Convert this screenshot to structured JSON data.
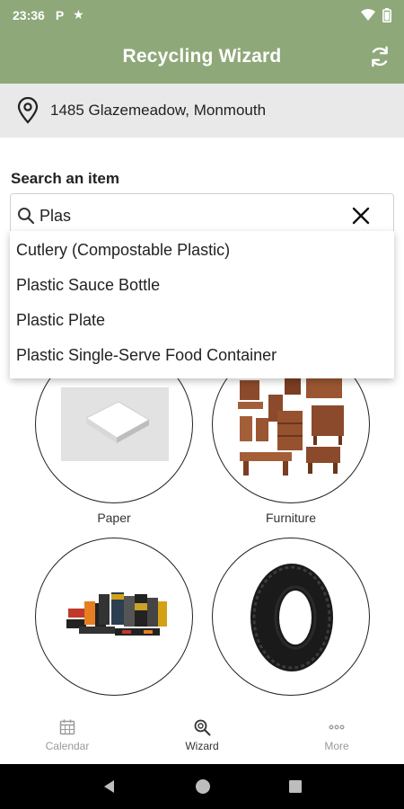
{
  "status_bar": {
    "time": "23:36",
    "icons": [
      "parking-icon",
      "star-icon",
      "wifi-icon",
      "battery-icon"
    ],
    "p_glyph": "P",
    "star_glyph": "★"
  },
  "app_bar": {
    "title": "Recycling Wizard",
    "action_icon": "refresh-icon"
  },
  "location": {
    "icon": "location-pin-icon",
    "address": "1485 Glazemeadow, Monmouth"
  },
  "search": {
    "label": "Search an item",
    "query": "Plas",
    "icon": "search-icon",
    "clear_icon": "close-icon",
    "suggestions": [
      "Cutlery (Compostable Plastic)",
      "Plastic Sauce Bottle",
      "Plastic Plate",
      "Plastic Single-Serve Food Container"
    ]
  },
  "categories": [
    {
      "label": "Paper",
      "image": "paper-stack-image"
    },
    {
      "label": "Furniture",
      "image": "furniture-collection-image"
    },
    {
      "label": "",
      "image": "batteries-image"
    },
    {
      "label": "",
      "image": "tire-image"
    }
  ],
  "bottom_nav": {
    "items": [
      {
        "label": "Calendar",
        "icon": "calendar-icon",
        "active": false
      },
      {
        "label": "Wizard",
        "icon": "wizard-search-icon",
        "active": true
      },
      {
        "label": "More",
        "icon": "more-dots-icon",
        "active": false
      }
    ]
  },
  "colors": {
    "app_bar": "#8fa87a",
    "address_bar": "#e9e9e9",
    "system_nav": "#000000"
  }
}
